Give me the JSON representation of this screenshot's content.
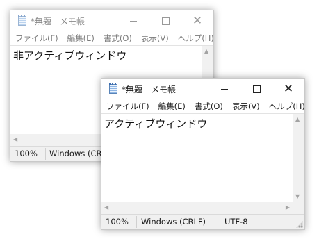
{
  "back_window": {
    "title": "*無題 - メモ帳",
    "menu": [
      "ファイル(F)",
      "編集(E)",
      "書式(O)",
      "表示(V)",
      "ヘルプ(H)"
    ],
    "text": "非アクティブウィンドウ",
    "status": {
      "zoom": "100%",
      "line_ending": "Windows (CRLF)"
    }
  },
  "front_window": {
    "title": "*無題 - メモ帳",
    "menu": [
      "ファイル(F)",
      "編集(E)",
      "書式(O)",
      "表示(V)",
      "ヘルプ(H)"
    ],
    "text": "アクティブウィンドウ",
    "status": {
      "zoom": "100%",
      "line_ending": "Windows (CRLF)",
      "encoding": "UTF-8"
    }
  },
  "icons": {
    "app": "notepad-icon",
    "minimize": "minimize-icon",
    "maximize": "maximize-icon",
    "close": "close-icon"
  }
}
